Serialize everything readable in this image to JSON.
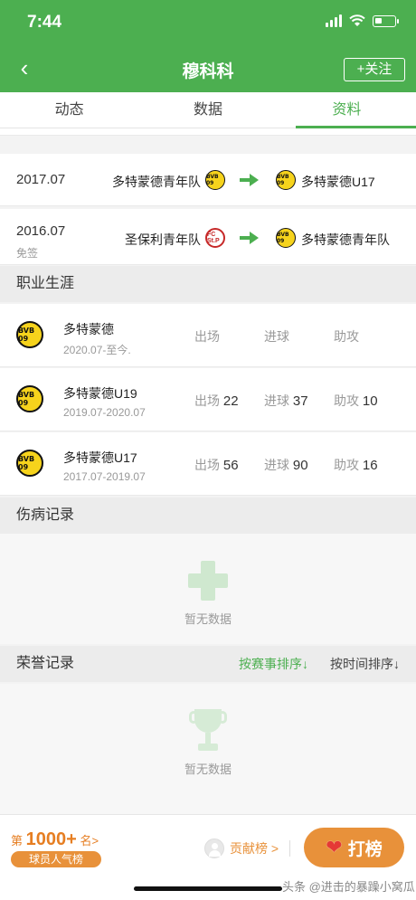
{
  "status_bar": {
    "time": "7:44"
  },
  "nav": {
    "title": "穆科科",
    "follow_label": "+关注",
    "back_icon": "‹"
  },
  "tabs": [
    {
      "label": "动态"
    },
    {
      "label": "数据"
    },
    {
      "label": "资料",
      "active": true
    }
  ],
  "transfers": [
    {
      "date": "2017.07",
      "sub": "",
      "from": "多特蒙德青年队",
      "to": "多特蒙德U17"
    },
    {
      "date": "2016.07",
      "sub": "免签",
      "from": "圣保利青年队",
      "to": "多特蒙德青年队"
    }
  ],
  "career": {
    "title": "职业生涯",
    "rows": [
      {
        "team": "多特蒙德",
        "period": "2020.07-至今.",
        "apps_label": "出场",
        "apps": "",
        "goals_label": "进球",
        "goals": "",
        "assists_label": "助攻",
        "assists": ""
      },
      {
        "team": "多特蒙德U19",
        "period": "2019.07-2020.07",
        "apps_label": "出场",
        "apps": "22",
        "goals_label": "进球",
        "goals": "37",
        "assists_label": "助攻",
        "assists": "10"
      },
      {
        "team": "多特蒙德U17",
        "period": "2017.07-2019.07",
        "apps_label": "出场",
        "apps": "56",
        "goals_label": "进球",
        "goals": "90",
        "assists_label": "助攻",
        "assists": "16"
      }
    ]
  },
  "injury": {
    "title": "伤病记录",
    "empty": "暂无数据"
  },
  "honors": {
    "title": "荣誉记录",
    "sort_by_event": "按赛事排序↓",
    "sort_by_time": "按时间排序↓",
    "empty": "暂无数据"
  },
  "club_badges": {
    "bvb": "BVB 09",
    "pauli": "FC St.P"
  },
  "bottom": {
    "rank_prefix": "第",
    "rank_value": "1000+",
    "rank_suffix": "名>",
    "rank_badge": "球员人气榜",
    "contrib_label": "贡献榜 >",
    "vote_label": "打榜"
  },
  "watermark": "头条 @进击的暴躁小窝瓜",
  "colors": {
    "brand_green": "#4caf50",
    "accent_orange": "#e8913a"
  }
}
